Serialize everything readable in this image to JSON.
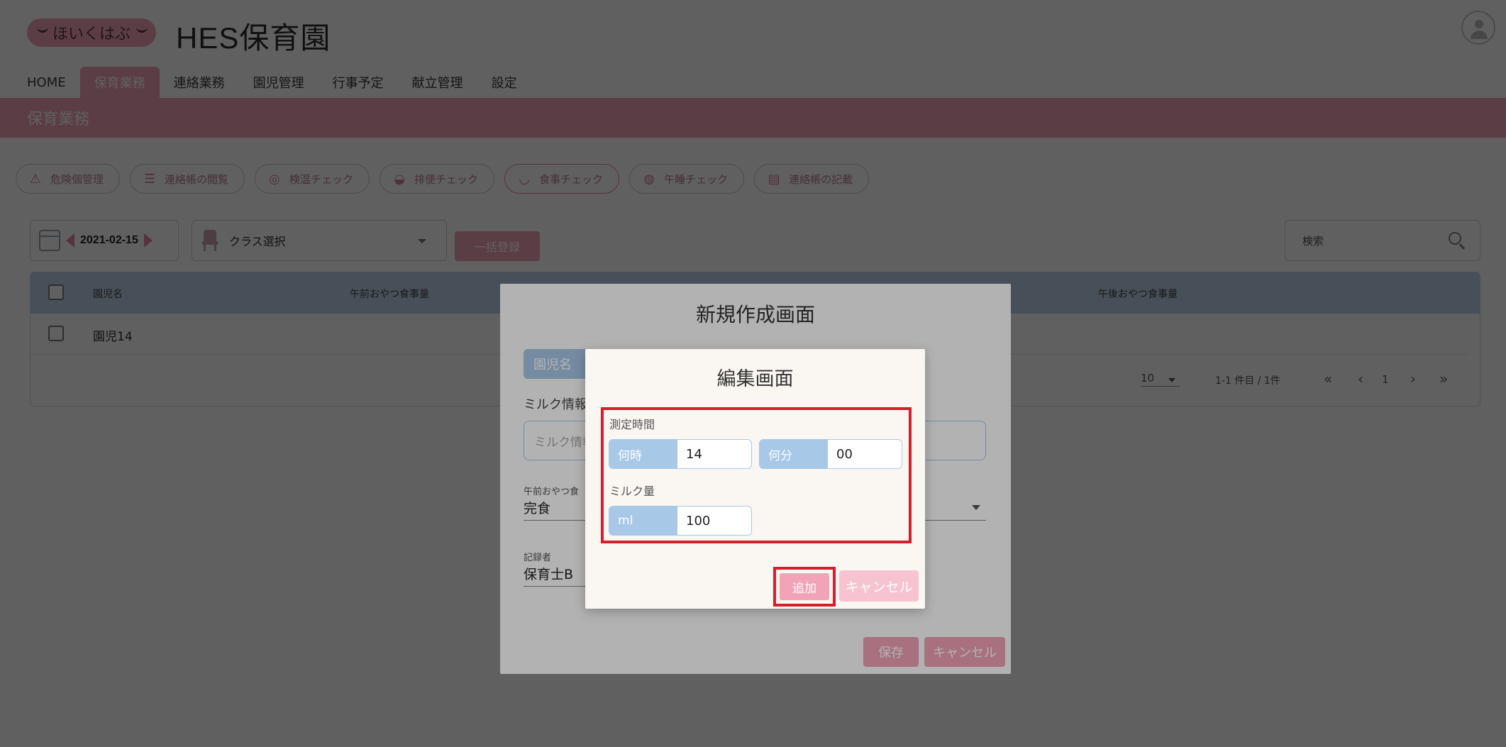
{
  "header": {
    "logo_text": "ほいくはぶ",
    "app_title": "HES保育園"
  },
  "nav": {
    "items": [
      {
        "label": "HOME",
        "active": false
      },
      {
        "label": "保育業務",
        "active": true
      },
      {
        "label": "連絡業務",
        "active": false
      },
      {
        "label": "園児管理",
        "active": false
      },
      {
        "label": "行事予定",
        "active": false
      },
      {
        "label": "献立管理",
        "active": false
      },
      {
        "label": "設定",
        "active": false
      }
    ]
  },
  "section": {
    "title": "保育業務"
  },
  "quick_actions": [
    {
      "label": "危険個管理",
      "icon": "warning-icon"
    },
    {
      "label": "連絡帳の閲覧",
      "icon": "list-icon"
    },
    {
      "label": "検温チェック",
      "icon": "thermometer-icon"
    },
    {
      "label": "排便チェック",
      "icon": "duck-icon"
    },
    {
      "label": "食事チェック",
      "icon": "bowl-icon",
      "active": true
    },
    {
      "label": "午睡チェック",
      "icon": "globe-icon"
    },
    {
      "label": "連絡帳の記載",
      "icon": "notebook-icon"
    }
  ],
  "toolbar": {
    "date": "2021-02-15",
    "class_select_label": "クラス選択",
    "bulk_button_label": "一括登録",
    "search_placeholder": "検索"
  },
  "table": {
    "headers": {
      "name": "園児名",
      "am_snack": "午前おやつ食事量",
      "pm_snack": "午後おやつ食事量"
    },
    "rows": [
      {
        "name": "園児14"
      }
    ],
    "pagination": {
      "per_page": "10",
      "range": "1-1 件目 / 1件",
      "page": "1"
    }
  },
  "dialog_new": {
    "title": "新規作成画面",
    "child_name_label": "園児名",
    "milk_info_label": "ミルク情報",
    "milk_info_placeholder": "ミルク情報",
    "am_snack_label": "午前おやつ食",
    "am_snack_value": "完食",
    "recorder_label": "記録者",
    "recorder_value": "保育士B",
    "save_label": "保存",
    "cancel_label": "キャンセル"
  },
  "dialog_edit": {
    "title": "編集画面",
    "measure_time_label": "測定時間",
    "hour_label": "何時",
    "hour_value": "14",
    "minute_label": "何分",
    "minute_value": "00",
    "milk_amount_label": "ミルク量",
    "ml_label": "ml",
    "ml_value": "100",
    "add_label": "追加",
    "cancel_label": "キャンセル"
  },
  "colors": {
    "brand_pink": "#f2a3b8",
    "header_blue": "#bcd4ec",
    "field_blue": "#a8c8e8",
    "highlight_red": "#d81e2c"
  }
}
